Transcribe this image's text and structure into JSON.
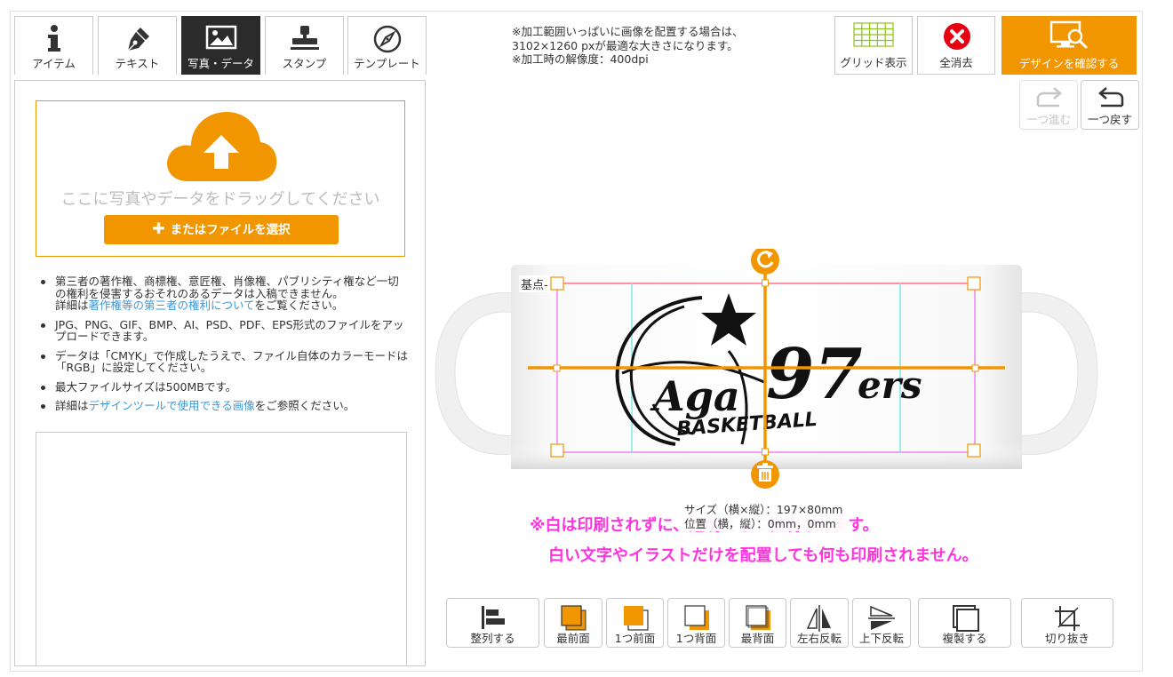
{
  "tabs": [
    {
      "label": "アイテム",
      "icon": "info-icon"
    },
    {
      "label": "テキスト",
      "icon": "pen-icon"
    },
    {
      "label": "写真・データ",
      "icon": "image-icon",
      "active": true
    },
    {
      "label": "スタンプ",
      "icon": "stamp-icon"
    },
    {
      "label": "テンプレート",
      "icon": "compass-icon"
    }
  ],
  "upload": {
    "drag_text": "ここに写真やデータをドラッグしてください",
    "file_button": "またはファイルを選択"
  },
  "notes": [
    {
      "before": "第三者の著作権、商標権、意匠権、肖像権、パブリシティ権など一切の権利を侵害するおそれのあるデータは入稿できません。",
      "prefix": "詳細は",
      "link": "著作権等の第三者の権利について",
      "after": "をご覧ください。"
    },
    {
      "text": "JPG、PNG、GIF、BMP、AI、PSD、PDF、EPS形式のファイルをアップロードできます。"
    },
    {
      "text": "データは「CMYK」で作成したうえで、ファイル自体のカラーモードは「RGB」に設定してください。"
    },
    {
      "text": "最大ファイルサイズは500MBです。"
    },
    {
      "prefix": "詳細は",
      "link": "デザインツールで使用できる画像",
      "after": "をご参照ください。"
    }
  ],
  "info": {
    "line1": "※加工範囲いっぱいに画像を配置する場合は、",
    "line2": "3102×1260 pxが最適な大きさになります。",
    "line3": "※加工時の解像度：400dpi"
  },
  "top_buttons": {
    "grid": "グリッド表示",
    "clear": "全消去",
    "confirm": "デザインを確認する"
  },
  "history": {
    "redo": "一つ進む",
    "undo": "一つ戻す"
  },
  "canvas": {
    "base_point": "基点",
    "size": "サイズ（横×縦）：197×80mm",
    "position": "位置（横，縦）：0mm，0mm",
    "design_text_main": "Aga",
    "design_text_number": "97",
    "design_text_suffix": "ers",
    "design_text_sub": "BASKETBALL"
  },
  "warnings": {
    "line1": "※白は印刷されずに、透明として表現されます。",
    "line2": "白い文字やイラストだけを配置しても何も印刷されません。"
  },
  "tools": {
    "align": "整列する",
    "front": "最前面",
    "forward": "1つ前面",
    "backward": "1つ背面",
    "back": "最背面",
    "flip_h": "左右反転",
    "flip_v": "上下反転",
    "duplicate": "複製する",
    "crop": "切り抜き"
  },
  "colors": {
    "accent": "#f29600",
    "warning": "#ff33e0",
    "link": "#3a98d9",
    "clear_red": "#e60012",
    "grid_green": "#8fc31f"
  }
}
